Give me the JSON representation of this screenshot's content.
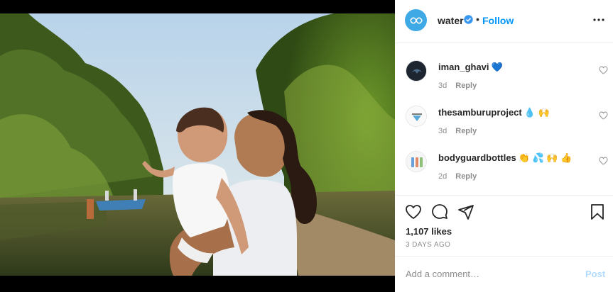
{
  "post": {
    "username": "water",
    "dot": "•",
    "follow_label": "Follow"
  },
  "comments": [
    {
      "user": "iman_ghavi",
      "emoji": "💙",
      "age": "3d",
      "reply": "Reply"
    },
    {
      "user": "thesamburuproject",
      "emoji": "💧 🙌",
      "age": "3d",
      "reply": "Reply"
    },
    {
      "user": "bodyguardbottles",
      "emoji": "👏 💦 🙌 👍",
      "age": "2d",
      "reply": "Reply"
    }
  ],
  "stats": {
    "likes": "1,107 likes",
    "date": "3 DAYS AGO"
  },
  "add_comment": {
    "placeholder": "Add a comment…",
    "post_label": "Post"
  },
  "colors": {
    "link_blue": "#0095f6",
    "post_disabled": "#b3dbff",
    "muted": "#8e8e8e",
    "avatar_blue": "#3fa9e5"
  },
  "icons": [
    "verified-badge-icon",
    "more-options-icon",
    "heart-icon",
    "comment-icon",
    "share-icon",
    "bookmark-icon"
  ]
}
